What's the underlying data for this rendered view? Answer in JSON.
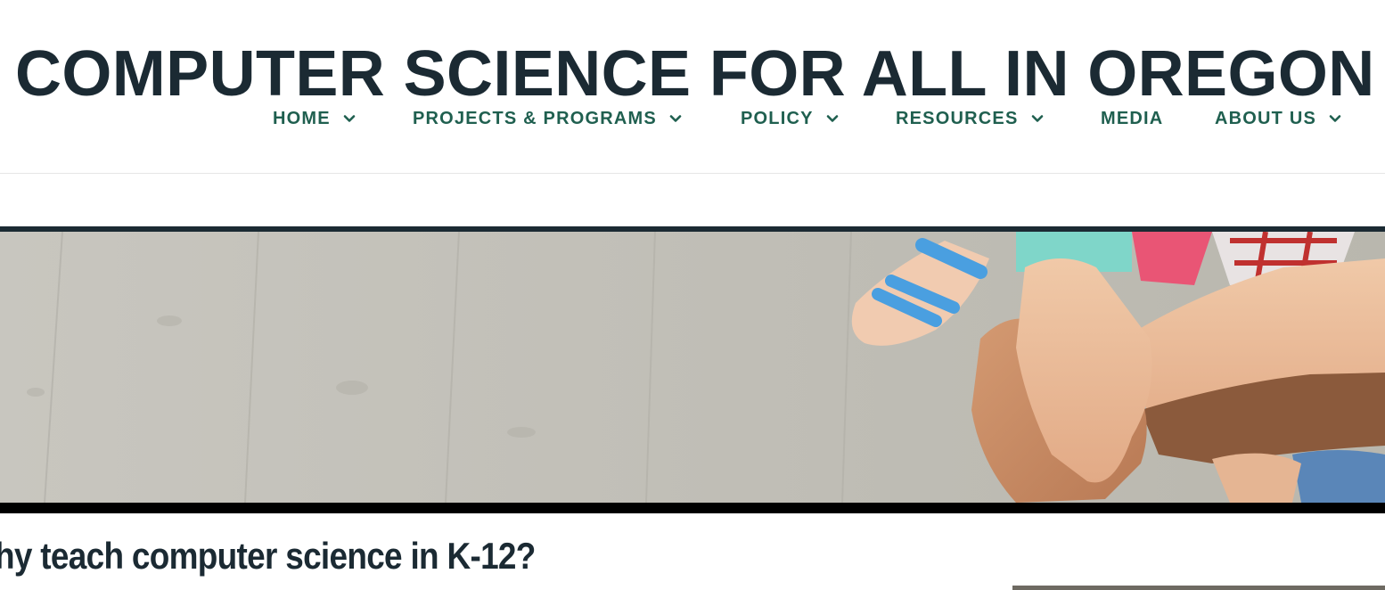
{
  "site": {
    "title": "COMPUTER SCIENCE FOR ALL IN OREGON"
  },
  "nav": {
    "items": [
      {
        "label": "HOME",
        "has_dropdown": true
      },
      {
        "label": "PROJECTS & PROGRAMS",
        "has_dropdown": true
      },
      {
        "label": "POLICY",
        "has_dropdown": true
      },
      {
        "label": "RESOURCES",
        "has_dropdown": true
      },
      {
        "label": "MEDIA",
        "has_dropdown": false
      },
      {
        "label": "ABOUT US",
        "has_dropdown": true
      }
    ]
  },
  "hero": {
    "image": "children-hands-stacked-photo"
  },
  "main": {
    "heading": "hy teach computer science in K-12?"
  },
  "colors": {
    "title": "#1b2a33",
    "nav": "#1f5f4f",
    "floor": "#c4c2ba",
    "band": "#1b2a33"
  }
}
